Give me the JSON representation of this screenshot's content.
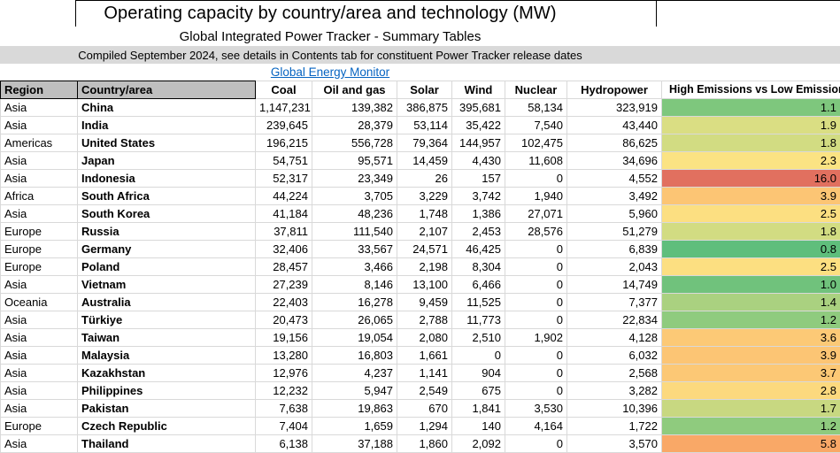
{
  "header": {
    "title": "Operating capacity by country/area and technology (MW)",
    "subtitle": "Global Integrated Power Tracker - Summary Tables",
    "compiled_note": "Compiled September 2024, see details in Contents tab for constituent Power Tracker release dates",
    "link_label": "Global Energy Monitor"
  },
  "colors": {
    "header_cell_gray": "#BFBFBF",
    "note_stripe_gray": "#D9D9D9",
    "link_blue": "#0563C1",
    "gridline": "#D9D9D9",
    "scale_low_green": "#5FBE7C",
    "scale_mid_yellow": "#FCDF81",
    "scale_high_red": "#E1705F"
  },
  "table": {
    "columns": [
      "Region",
      "Country/area",
      "Coal",
      "Oil and gas",
      "Solar",
      "Wind",
      "Nuclear",
      "Hydropower",
      "High Emissions vs Low Emissions"
    ],
    "rows": [
      {
        "region": "Asia",
        "country": "China",
        "coal": "1,147,231",
        "oil_gas": "139,382",
        "solar": "386,875",
        "wind": "395,681",
        "nuclear": "58,134",
        "hydro": "323,919",
        "ratio": "1.1",
        "ratio_color": "#7EC77D"
      },
      {
        "region": "Asia",
        "country": "India",
        "coal": "239,645",
        "oil_gas": "28,379",
        "solar": "53,114",
        "wind": "35,422",
        "nuclear": "7,540",
        "hydro": "43,440",
        "ratio": "1.9",
        "ratio_color": "#DADE83"
      },
      {
        "region": "Americas",
        "country": "United States",
        "coal": "196,215",
        "oil_gas": "556,728",
        "solar": "79,364",
        "wind": "144,957",
        "nuclear": "102,475",
        "hydro": "86,625",
        "ratio": "1.8",
        "ratio_color": "#D2DC82"
      },
      {
        "region": "Asia",
        "country": "Japan",
        "coal": "54,751",
        "oil_gas": "95,571",
        "solar": "14,459",
        "wind": "4,430",
        "nuclear": "11,608",
        "hydro": "34,696",
        "ratio": "2.3",
        "ratio_color": "#FBE383"
      },
      {
        "region": "Asia",
        "country": "Indonesia",
        "coal": "52,317",
        "oil_gas": "23,349",
        "solar": "26",
        "wind": "157",
        "nuclear": "0",
        "hydro": "4,552",
        "ratio": "16.0",
        "ratio_color": "#E1705F"
      },
      {
        "region": "Africa",
        "country": "South Africa",
        "coal": "44,224",
        "oil_gas": "3,705",
        "solar": "3,229",
        "wind": "3,742",
        "nuclear": "1,940",
        "hydro": "3,492",
        "ratio": "3.9",
        "ratio_color": "#FCC574"
      },
      {
        "region": "Asia",
        "country": "South Korea",
        "coal": "41,184",
        "oil_gas": "48,236",
        "solar": "1,748",
        "wind": "1,386",
        "nuclear": "27,071",
        "hydro": "5,960",
        "ratio": "2.5",
        "ratio_color": "#FCDF81"
      },
      {
        "region": "Europe",
        "country": "Russia",
        "coal": "37,811",
        "oil_gas": "111,540",
        "solar": "2,107",
        "wind": "2,453",
        "nuclear": "28,576",
        "hydro": "51,279",
        "ratio": "1.8",
        "ratio_color": "#D2DC82"
      },
      {
        "region": "Europe",
        "country": "Germany",
        "coal": "32,406",
        "oil_gas": "33,567",
        "solar": "24,571",
        "wind": "46,425",
        "nuclear": "0",
        "hydro": "6,839",
        "ratio": "0.8",
        "ratio_color": "#5FBE7C"
      },
      {
        "region": "Europe",
        "country": "Poland",
        "coal": "28,457",
        "oil_gas": "3,466",
        "solar": "2,198",
        "wind": "8,304",
        "nuclear": "0",
        "hydro": "2,043",
        "ratio": "2.5",
        "ratio_color": "#FCDF81"
      },
      {
        "region": "Asia",
        "country": "Vietnam",
        "coal": "27,239",
        "oil_gas": "8,146",
        "solar": "13,100",
        "wind": "6,466",
        "nuclear": "0",
        "hydro": "14,749",
        "ratio": "1.0",
        "ratio_color": "#70C27C"
      },
      {
        "region": "Oceania",
        "country": "Australia",
        "coal": "22,403",
        "oil_gas": "16,278",
        "solar": "9,459",
        "wind": "11,525",
        "nuclear": "0",
        "hydro": "7,377",
        "ratio": "1.4",
        "ratio_color": "#AAD180"
      },
      {
        "region": "Asia",
        "country": "Türkiye",
        "coal": "20,473",
        "oil_gas": "26,065",
        "solar": "2,788",
        "wind": "11,773",
        "nuclear": "0",
        "hydro": "22,834",
        "ratio": "1.2",
        "ratio_color": "#8FCB7E"
      },
      {
        "region": "Asia",
        "country": "Taiwan",
        "coal": "19,156",
        "oil_gas": "19,054",
        "solar": "2,080",
        "wind": "2,510",
        "nuclear": "1,902",
        "hydro": "4,128",
        "ratio": "3.6",
        "ratio_color": "#FCC976"
      },
      {
        "region": "Asia",
        "country": "Malaysia",
        "coal": "13,280",
        "oil_gas": "16,803",
        "solar": "1,661",
        "wind": "0",
        "nuclear": "0",
        "hydro": "6,032",
        "ratio": "3.9",
        "ratio_color": "#FCC574"
      },
      {
        "region": "Asia",
        "country": "Kazakhstan",
        "coal": "12,976",
        "oil_gas": "4,237",
        "solar": "1,141",
        "wind": "904",
        "nuclear": "0",
        "hydro": "2,568",
        "ratio": "3.7",
        "ratio_color": "#FCC875"
      },
      {
        "region": "Asia",
        "country": "Philippines",
        "coal": "12,232",
        "oil_gas": "5,947",
        "solar": "2,549",
        "wind": "675",
        "nuclear": "0",
        "hydro": "3,282",
        "ratio": "2.8",
        "ratio_color": "#FCD97E"
      },
      {
        "region": "Asia",
        "country": "Pakistan",
        "coal": "7,638",
        "oil_gas": "19,863",
        "solar": "670",
        "wind": "1,841",
        "nuclear": "3,530",
        "hydro": "10,396",
        "ratio": "1.7",
        "ratio_color": "#C8D881"
      },
      {
        "region": "Europe",
        "country": "Czech Republic",
        "coal": "7,404",
        "oil_gas": "1,659",
        "solar": "1,294",
        "wind": "140",
        "nuclear": "4,164",
        "hydro": "1,722",
        "ratio": "1.2",
        "ratio_color": "#8FCB7E"
      },
      {
        "region": "Asia",
        "country": "Thailand",
        "coal": "6,138",
        "oil_gas": "37,188",
        "solar": "1,860",
        "wind": "2,092",
        "nuclear": "0",
        "hydro": "3,570",
        "ratio": "5.8",
        "ratio_color": "#F9A867"
      }
    ]
  }
}
